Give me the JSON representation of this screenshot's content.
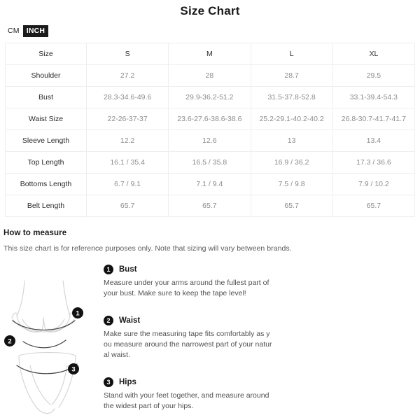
{
  "header": {
    "title": "Size Chart"
  },
  "unit_toggle": {
    "options": [
      {
        "label": "CM",
        "active": false
      },
      {
        "label": "INCH",
        "active": true
      }
    ],
    "active_unit": "INCH",
    "active_bg": "#1b1b1b",
    "active_fg": "#ffffff"
  },
  "size_table": {
    "columns": [
      "Size",
      "S",
      "M",
      "L",
      "XL"
    ],
    "rows": [
      {
        "label": "Shoulder",
        "values": [
          "27.2",
          "28",
          "28.7",
          "29.5"
        ]
      },
      {
        "label": "Bust",
        "values": [
          "28.3-34.6-49.6",
          "29.9-36.2-51.2",
          "31.5-37.8-52.8",
          "33.1-39.4-54.3"
        ]
      },
      {
        "label": "Waist Size",
        "values": [
          "22-26-37-37",
          "23.6-27.6-38.6-38.6",
          "25.2-29.1-40.2-40.2",
          "26.8-30.7-41.7-41.7"
        ]
      },
      {
        "label": "Sleeve Length",
        "values": [
          "12.2",
          "12.6",
          "13",
          "13.4"
        ]
      },
      {
        "label": "Top Length",
        "values": [
          "16.1 / 35.4",
          "16.5 / 35.8",
          "16.9 / 36.2",
          "17.3 / 36.6"
        ]
      },
      {
        "label": "Bottoms Length",
        "values": [
          "6.7 / 9.1",
          "7.1 / 9.4",
          "7.5 / 9.8",
          "7.9 / 10.2"
        ]
      },
      {
        "label": "Belt Length",
        "values": [
          "65.7",
          "65.7",
          "65.7",
          "65.7"
        ]
      }
    ]
  },
  "how_to_measure": {
    "heading": "How to measure",
    "note": "This size chart is for reference purposes only. Note that sizing will vary between brands.",
    "steps": [
      {
        "number": "1",
        "title": "Bust",
        "text": "Measure under your arms around the fullest part of your bust. Make sure to keep the tape level!"
      },
      {
        "number": "2",
        "title": "Waist",
        "text": "Make sure the measuring tape fits comfortably as you measure around the narrowest part of your natural waist."
      },
      {
        "number": "3",
        "title": "Hips",
        "text": "Stand with your feet together, and measure around the widest part of your hips."
      }
    ]
  },
  "figure": {
    "markers": [
      "1",
      "2",
      "3"
    ],
    "alt": "bikini-measurement-diagram"
  },
  "colors": {
    "text_primary": "#1c1c1c",
    "text_secondary": "#8c8c8c",
    "table_border": "#eeeeee",
    "badge_bg": "#111111"
  }
}
